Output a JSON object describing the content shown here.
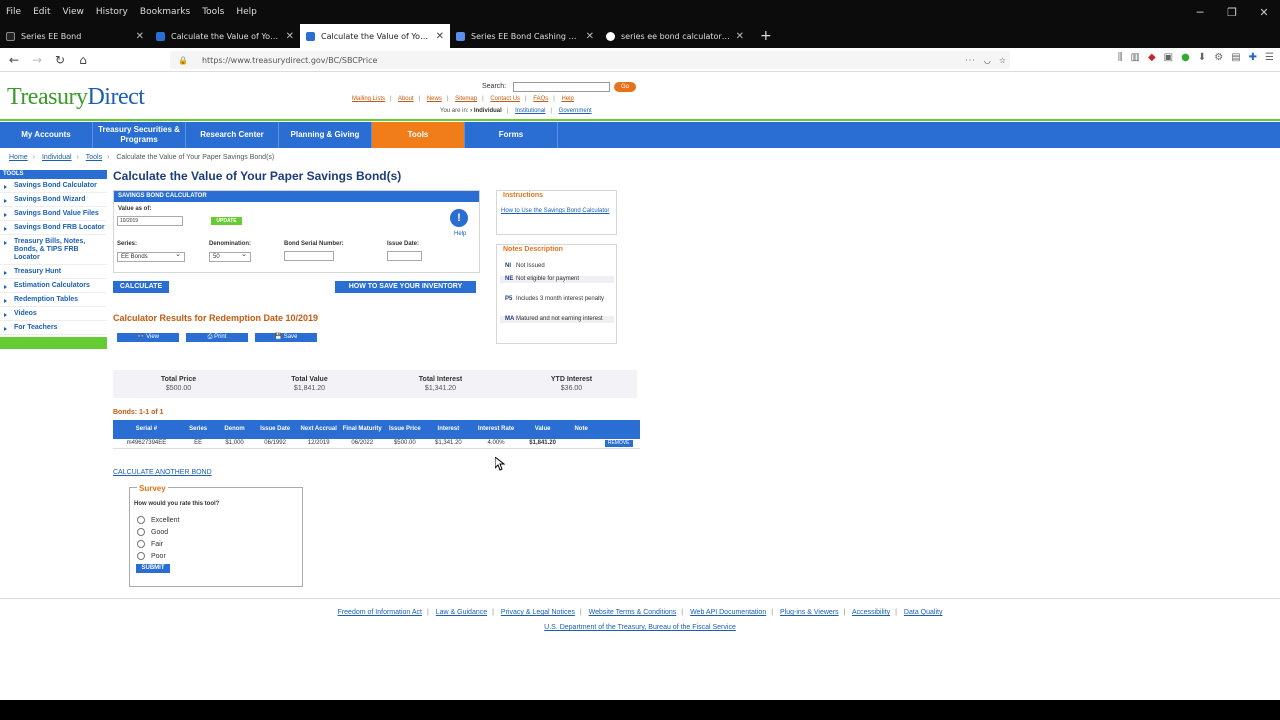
{
  "browser": {
    "menu": [
      "File",
      "Edit",
      "View",
      "History",
      "Bookmarks",
      "Tools",
      "Help"
    ],
    "tabs": [
      {
        "title": "Series EE Bond",
        "active": false
      },
      {
        "title": "Calculate the Value of Your Pap",
        "active": false
      },
      {
        "title": "Calculate the Value of Your Pap",
        "active": true
      },
      {
        "title": "Series EE Bond Cashing Video",
        "active": false
      },
      {
        "title": "series ee bond calculator - Goo",
        "active": false
      }
    ],
    "url": "https://www.treasurydirect.gov/BC/SBCPrice"
  },
  "header": {
    "logo_part1": "Treasury",
    "logo_part2": "Direct",
    "search_label": "Search:",
    "go_label": "Go",
    "top_links": [
      "Mailing Lists",
      "About",
      "News",
      "Sitemap",
      "Contact Us",
      "FAQs",
      "Help"
    ],
    "you_are_in": "You are in:",
    "audiences": [
      "Individual",
      "Institutional",
      "Government"
    ]
  },
  "nav": {
    "items": [
      "My Accounts",
      "Treasury Securities & Programs",
      "Research Center",
      "Planning & Giving",
      "Tools",
      "Forms"
    ]
  },
  "breadcrumb": [
    "Home",
    "Individual",
    "Tools",
    "Calculate the Value of Your Paper Savings Bond(s)"
  ],
  "sidebar": {
    "heading": "TOOLS",
    "items": [
      "Savings Bond Calculator",
      "Savings Bond Wizard",
      "Savings Bond Value Files",
      "Savings Bond FRB Locator",
      "Treasury Bills, Notes, Bonds, & TIPS FRB Locator",
      "Treasury Hunt",
      "Estimation Calculators",
      "Redemption Tables",
      "Videos",
      "For Teachers"
    ]
  },
  "page": {
    "title": "Calculate the Value of Your Paper Savings Bond(s)"
  },
  "calculator": {
    "heading": "SAVINGS BOND CALCULATOR",
    "value_as_of_label": "Value as of:",
    "value_as_of": "10/2019",
    "update_label": "UPDATE",
    "help_label": "Help",
    "series_label": "Series:",
    "series_value": "EE Bonds",
    "denomination_label": "Denomination:",
    "denomination_value": "50",
    "serial_label": "Bond Serial Number:",
    "serial_value": "",
    "issue_date_label": "Issue Date:",
    "issue_date_value": "",
    "calculate_label": "CALCULATE",
    "save_inventory_label": "HOW TO SAVE YOUR INVENTORY"
  },
  "results": {
    "title": "Calculator Results for Redemption Date 10/2019",
    "actions": [
      "View",
      "Print",
      "Save"
    ],
    "totals": [
      {
        "label": "Total Price",
        "value": "$500.00"
      },
      {
        "label": "Total Value",
        "value": "$1,841.20"
      },
      {
        "label": "Total Interest",
        "value": "$1,341.20"
      },
      {
        "label": "YTD Interest",
        "value": "$36.00"
      }
    ],
    "bonds_count": "Bonds: 1-1 of 1",
    "columns": [
      "Serial #",
      "Series",
      "Denom",
      "Issue Date",
      "Next Accrual",
      "Final Maturity",
      "Issue Price",
      "Interest",
      "Interest Rate",
      "Value",
      "Note",
      ""
    ],
    "rows": [
      [
        "m49627394EE",
        "EE",
        "$1,000",
        "06/1992",
        "12/2019",
        "06/2022",
        "$500.00",
        "$1,341.20",
        "4.00%",
        "$1,841.20",
        "",
        "REMOVE"
      ]
    ],
    "calculate_another": "CALCULATE ANOTHER BOND"
  },
  "survey": {
    "title": "Survey",
    "question": "How would you rate this tool?",
    "options": [
      "Excellent",
      "Good",
      "Fair",
      "Poor"
    ],
    "submit_label": "SUBMIT"
  },
  "instructions": {
    "heading": "Instructions",
    "link": "How to Use the Savings Bond Calculator"
  },
  "notes": {
    "heading": "Notes Description",
    "items": [
      {
        "code": "NI",
        "desc": "Not Issued"
      },
      {
        "code": "NE",
        "desc": "Not eligible for payment"
      },
      {
        "code": "P5",
        "desc": "Includes 3 month interest penalty"
      },
      {
        "code": "MA",
        "desc": "Matured and not earning interest"
      }
    ]
  },
  "footer": {
    "links": [
      "Freedom of Information Act",
      "Law & Guidance",
      "Privacy & Legal Notices",
      "Website Terms & Conditions",
      "Web API Documentation",
      "Plug-ins & Viewers",
      "Accessibility",
      "Data Quality"
    ],
    "bureau": "U.S. Department of the Treasury, Bureau of the Fiscal Service"
  },
  "colors": {
    "nav_blue": "#2a6ed3",
    "tools_orange": "#f07c1a",
    "accent_green": "#66cc33",
    "heading_orange": "#c65a11"
  }
}
